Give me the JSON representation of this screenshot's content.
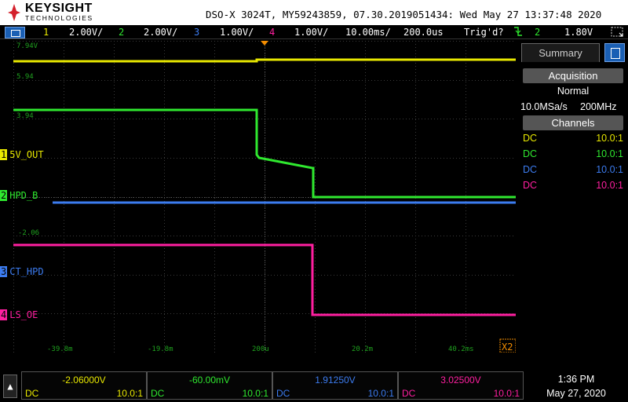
{
  "header": {
    "brand": "KEYSIGHT",
    "brand_sub": "TECHNOLOGIES",
    "info": "DSO-X 3024T, MY59243859, 07.30.2019051434: Wed May 27 13:37:48 2020"
  },
  "settings_bar": {
    "channels": [
      {
        "num": "1",
        "scale": "2.00V/",
        "color": "#e8e800"
      },
      {
        "num": "2",
        "scale": "2.00V/",
        "color": "#2fe82f"
      },
      {
        "num": "3",
        "scale": "1.00V/",
        "color": "#3c7cf0"
      },
      {
        "num": "4",
        "scale": "1.00V/",
        "color": "#ff1fa0"
      }
    ],
    "timebase": "10.00ms/",
    "delay": "200.0us",
    "trigger_state": "Trig'd?",
    "trigger_slope_icon": "falling-edge-icon",
    "trigger_channel": "2",
    "trigger_level": "1.80V"
  },
  "plot": {
    "grid_labels_y": [
      "7.94V",
      "5.94",
      "3.94",
      "-2.06"
    ],
    "grid_labels_x": [
      "-39.8m",
      "-19.8m",
      "200u",
      "20.2m",
      "40.2ms"
    ],
    "zoom_badge": "X2",
    "markers": [
      {
        "num": "1",
        "label": "5V_OUT",
        "color": "#e8e800"
      },
      {
        "num": "2",
        "label": "HPD_B",
        "color": "#2fe82f"
      },
      {
        "num": "3",
        "label": "CT_HPD",
        "color": "#3c7cf0"
      },
      {
        "num": "4",
        "label": "LS_OE",
        "color": "#ff1fa0"
      }
    ]
  },
  "panel": {
    "tab": "Summary",
    "acquisition_header": "Acquisition",
    "acq_mode": "Normal",
    "sample_rate": "10.0MSa/s",
    "bandwidth": "200MHz",
    "channels_header": "Channels",
    "channels": [
      {
        "coupling": "DC",
        "probe": "10.0:1",
        "color": "#e8e800"
      },
      {
        "coupling": "DC",
        "probe": "10.0:1",
        "color": "#2fe82f"
      },
      {
        "coupling": "DC",
        "probe": "10.0:1",
        "color": "#3c7cf0"
      },
      {
        "coupling": "DC",
        "probe": "10.0:1",
        "color": "#ff1fa0"
      }
    ]
  },
  "bottom": {
    "measurements": [
      {
        "value": "-2.06000V",
        "coupling": "DC",
        "probe": "10.0:1",
        "color": "#e8e800"
      },
      {
        "value": "-60.00mV",
        "coupling": "DC",
        "probe": "10.0:1",
        "color": "#2fe82f"
      },
      {
        "value": "1.91250V",
        "coupling": "DC",
        "probe": "10.0:1",
        "color": "#3c7cf0"
      },
      {
        "value": "3.02500V",
        "coupling": "DC",
        "probe": "10.0:1",
        "color": "#ff1fa0"
      }
    ],
    "time": "1:36 PM",
    "date": "May 27, 2020"
  }
}
